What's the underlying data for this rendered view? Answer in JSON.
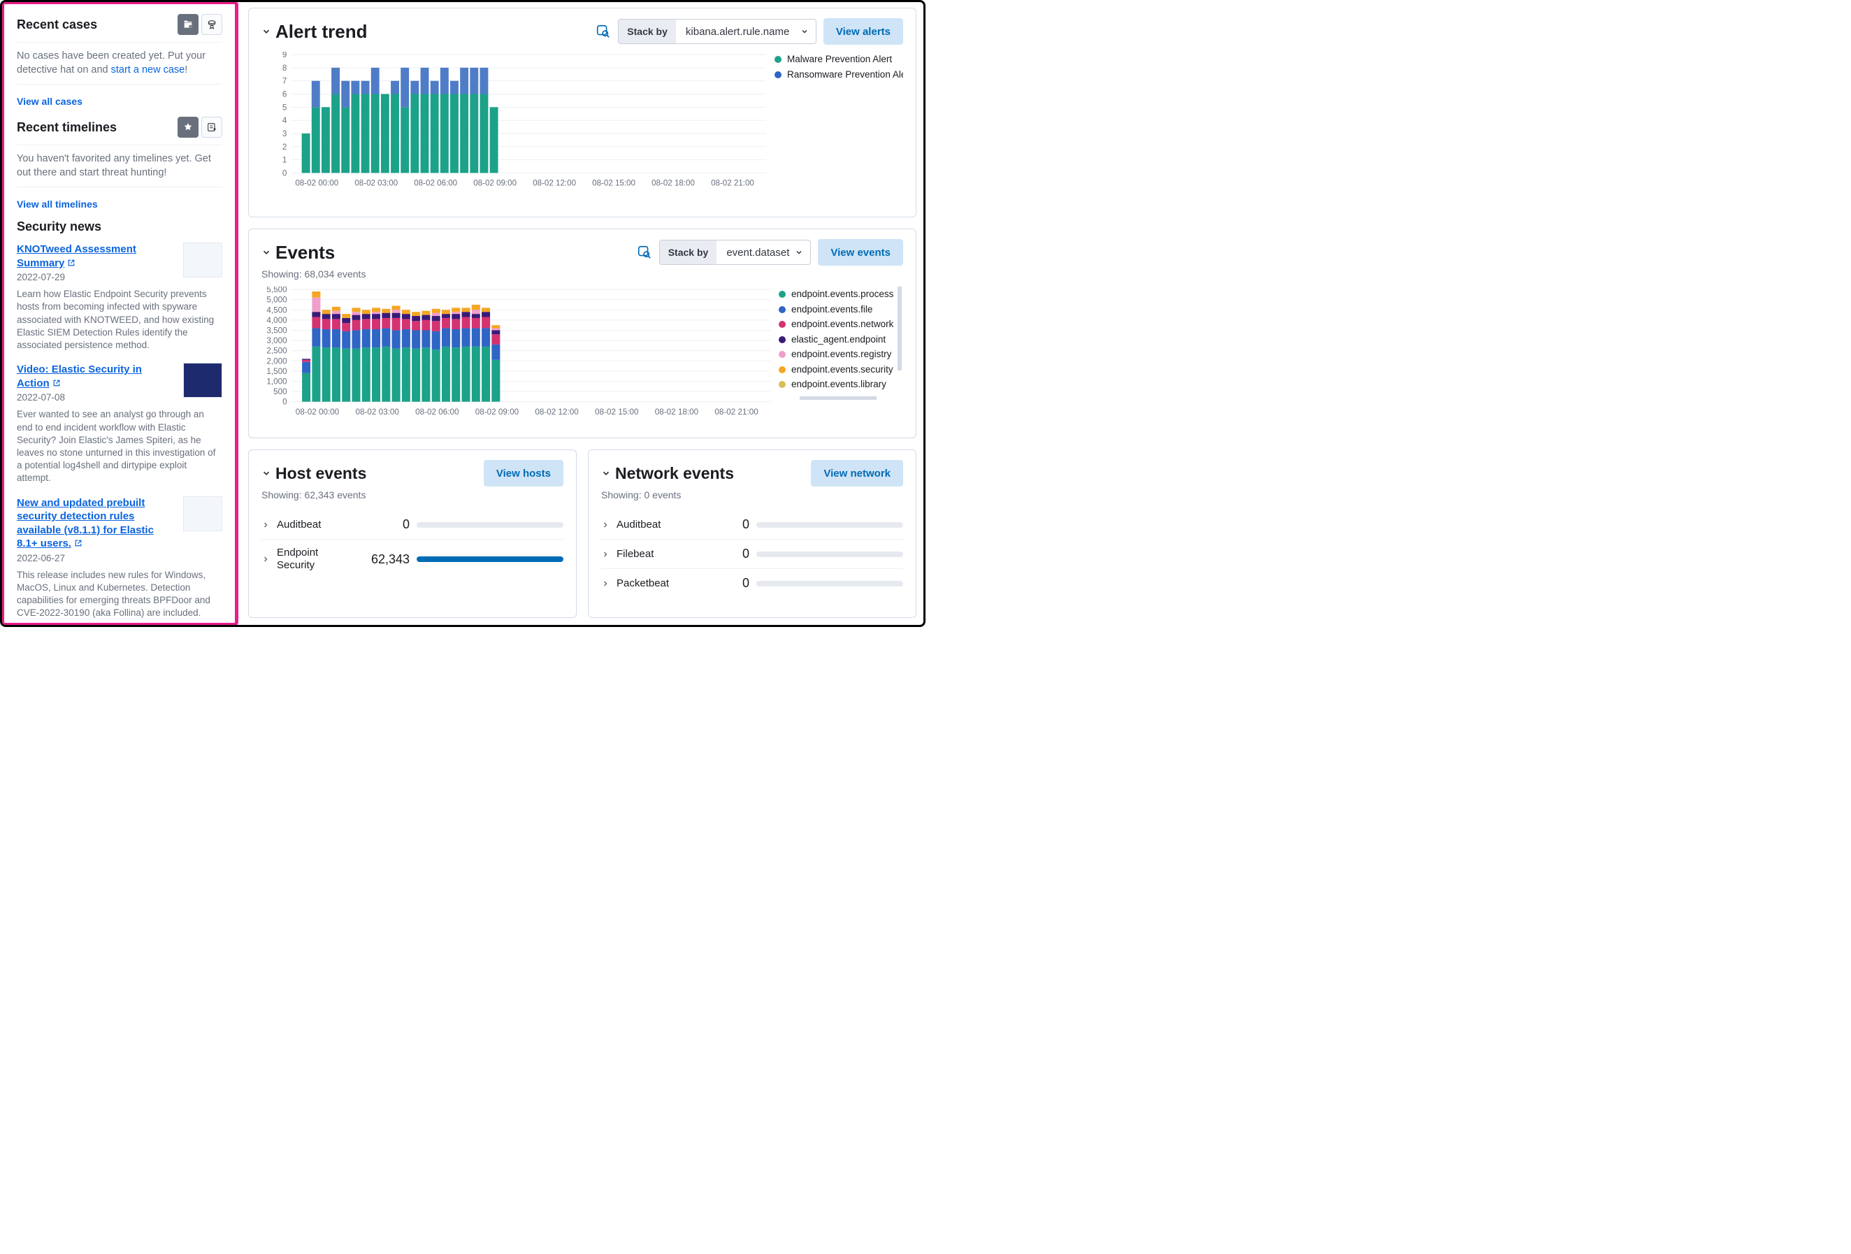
{
  "sidebar": {
    "recent_cases": {
      "title": "Recent cases",
      "body_prefix": "No cases have been created yet. Put your detective hat on and ",
      "body_link": "start a new case",
      "body_suffix": "!",
      "view_all": "View all cases"
    },
    "recent_timelines": {
      "title": "Recent timelines",
      "body": "You haven't favorited any timelines yet. Get out there and start threat hunting!",
      "view_all": "View all timelines"
    },
    "security_news": {
      "title": "Security news",
      "items": [
        {
          "title": "KNOTweed Assessment Summary",
          "date": "2022-07-29",
          "desc": "Learn how Elastic Endpoint Security prevents hosts from becoming infected with spyware associated with KNOTWEED, and how existing Elastic SIEM Detection Rules identify the associated persistence method."
        },
        {
          "title": "Video: Elastic Security in Action",
          "date": "2022-07-08",
          "desc": "Ever wanted to see an analyst go through an end to end incident workflow with Elastic Security? Join Elastic's James Spiteri, as he leaves no stone unturned in this investigation of a potential log4shell and dirtypipe exploit attempt."
        },
        {
          "title": "New and updated prebuilt security detection rules available (v8.1.1) for Elastic 8.1+ users.",
          "date": "2022-06-27",
          "desc": "This release includes new rules for Windows, MacOS, Linux and Kubernetes. Detection capabilities for emerging threats BPFDoor and CVE-2022-30190 (aka Follina) are included."
        }
      ]
    }
  },
  "alert_trend": {
    "title": "Alert trend",
    "stack_by_label": "Stack by",
    "stack_by_value": "kibana.alert.rule.name",
    "view_btn": "View alerts",
    "legend": [
      {
        "label": "Malware Prevention Alert",
        "color": "#1ba288"
      },
      {
        "label": "Ransomware Prevention Alert",
        "color": "#2f65c4"
      }
    ]
  },
  "events": {
    "title": "Events",
    "showing": "Showing: 68,034 events",
    "stack_by_label": "Stack by",
    "stack_by_value": "event.dataset",
    "view_btn": "View events",
    "legend": [
      {
        "label": "endpoint.events.process",
        "color": "#1ba288"
      },
      {
        "label": "endpoint.events.file",
        "color": "#2f65c4"
      },
      {
        "label": "endpoint.events.network",
        "color": "#d53272"
      },
      {
        "label": "elastic_agent.endpoint",
        "color": "#3a1a78"
      },
      {
        "label": "endpoint.events.registry",
        "color": "#f19ecb"
      },
      {
        "label": "endpoint.events.security",
        "color": "#f5a623"
      },
      {
        "label": "endpoint.events.library",
        "color": "#d6bf57"
      }
    ]
  },
  "host_events": {
    "title": "Host events",
    "showing": "Showing: 62,343 events",
    "view_btn": "View hosts",
    "rows": [
      {
        "name": "Auditbeat",
        "count": "0",
        "pct": 0
      },
      {
        "name": "Endpoint Security",
        "count": "62,343",
        "pct": 100
      }
    ]
  },
  "network_events": {
    "title": "Network events",
    "showing": "Showing: 0 events",
    "view_btn": "View network",
    "rows": [
      {
        "name": "Auditbeat",
        "count": "0",
        "pct": 0
      },
      {
        "name": "Filebeat",
        "count": "0",
        "pct": 0
      },
      {
        "name": "Packetbeat",
        "count": "0",
        "pct": 0
      }
    ]
  },
  "chart_data": [
    {
      "type": "bar",
      "title": "Alert trend",
      "xlabel": "",
      "ylabel": "",
      "ylim": [
        0,
        9
      ],
      "x_ticks": [
        "08-02 00:00",
        "08-02 03:00",
        "08-02 06:00",
        "08-02 09:00",
        "08-02 12:00",
        "08-02 15:00",
        "08-02 18:00",
        "08-02 21:00"
      ],
      "x": [
        "08-02 00:00",
        "08-02 00:30",
        "08-02 01:00",
        "08-02 01:30",
        "08-02 02:00",
        "08-02 02:30",
        "08-02 03:00",
        "08-02 03:30",
        "08-02 04:00",
        "08-02 04:30",
        "08-02 05:00",
        "08-02 05:30",
        "08-02 06:00",
        "08-02 06:30",
        "08-02 07:00",
        "08-02 07:30",
        "08-02 08:00",
        "08-02 08:30",
        "08-02 09:00",
        "08-02 09:30",
        "08-02 10:00",
        "08-02 10:30"
      ],
      "series": [
        {
          "name": "Malware Prevention Alert",
          "color": "#1ba288",
          "values": [
            0,
            3,
            5,
            5,
            6,
            5,
            6,
            6,
            6,
            6,
            6,
            5,
            6,
            6,
            6,
            6,
            6,
            6,
            6,
            6,
            5,
            0
          ]
        },
        {
          "name": "Ransomware Prevention Alert",
          "color": "#4f7cc7",
          "values": [
            0,
            0,
            2,
            0,
            2,
            2,
            1,
            1,
            2,
            0,
            1,
            3,
            1,
            2,
            1,
            2,
            1,
            2,
            2,
            2,
            0,
            0
          ]
        }
      ]
    },
    {
      "type": "bar",
      "title": "Events",
      "xlabel": "",
      "ylabel": "",
      "ylim": [
        0,
        5500
      ],
      "x_ticks": [
        "08-02 00:00",
        "08-02 03:00",
        "08-02 06:00",
        "08-02 09:00",
        "08-02 12:00",
        "08-02 15:00",
        "08-02 18:00",
        "08-02 21:00"
      ],
      "yticks": [
        0,
        500,
        1000,
        1500,
        2000,
        2500,
        3000,
        3500,
        4000,
        4500,
        5000,
        5500
      ],
      "x": [
        "08-02 00:00",
        "08-02 00:30",
        "08-02 01:00",
        "08-02 01:30",
        "08-02 02:00",
        "08-02 02:30",
        "08-02 03:00",
        "08-02 03:30",
        "08-02 04:00",
        "08-02 04:30",
        "08-02 05:00",
        "08-02 05:30",
        "08-02 06:00",
        "08-02 06:30",
        "08-02 07:00",
        "08-02 07:30",
        "08-02 08:00",
        "08-02 08:30",
        "08-02 09:00",
        "08-02 09:30",
        "08-02 10:00",
        "08-02 10:30"
      ],
      "series": [
        {
          "name": "endpoint.events.process",
          "color": "#1ba288",
          "values": [
            0,
            1400,
            2700,
            2650,
            2650,
            2600,
            2600,
            2650,
            2650,
            2700,
            2600,
            2650,
            2600,
            2650,
            2550,
            2700,
            2650,
            2700,
            2700,
            2700,
            2050,
            0
          ]
        },
        {
          "name": "endpoint.events.file",
          "color": "#2f65c4",
          "values": [
            0,
            550,
            900,
            900,
            900,
            850,
            900,
            900,
            900,
            900,
            900,
            900,
            900,
            850,
            900,
            900,
            900,
            900,
            900,
            900,
            750,
            0
          ]
        },
        {
          "name": "endpoint.events.network",
          "color": "#d53272",
          "values": [
            0,
            100,
            550,
            500,
            500,
            400,
            500,
            500,
            500,
            500,
            600,
            500,
            450,
            500,
            500,
            500,
            500,
            550,
            500,
            550,
            500,
            0
          ]
        },
        {
          "name": "elastic_agent.endpoint",
          "color": "#3a1a78",
          "values": [
            0,
            50,
            250,
            250,
            250,
            250,
            250,
            250,
            250,
            250,
            250,
            250,
            250,
            250,
            250,
            200,
            250,
            250,
            200,
            250,
            200,
            0
          ]
        },
        {
          "name": "endpoint.events.registry",
          "color": "#f19ecb",
          "values": [
            0,
            0,
            700,
            0,
            150,
            0,
            150,
            0,
            100,
            0,
            150,
            0,
            0,
            0,
            150,
            0,
            100,
            0,
            200,
            0,
            100,
            0
          ]
        },
        {
          "name": "endpoint.events.security",
          "color": "#f5a623",
          "values": [
            0,
            0,
            300,
            200,
            200,
            200,
            200,
            200,
            200,
            200,
            200,
            200,
            200,
            200,
            200,
            200,
            200,
            200,
            250,
            200,
            150,
            0
          ]
        }
      ]
    }
  ]
}
